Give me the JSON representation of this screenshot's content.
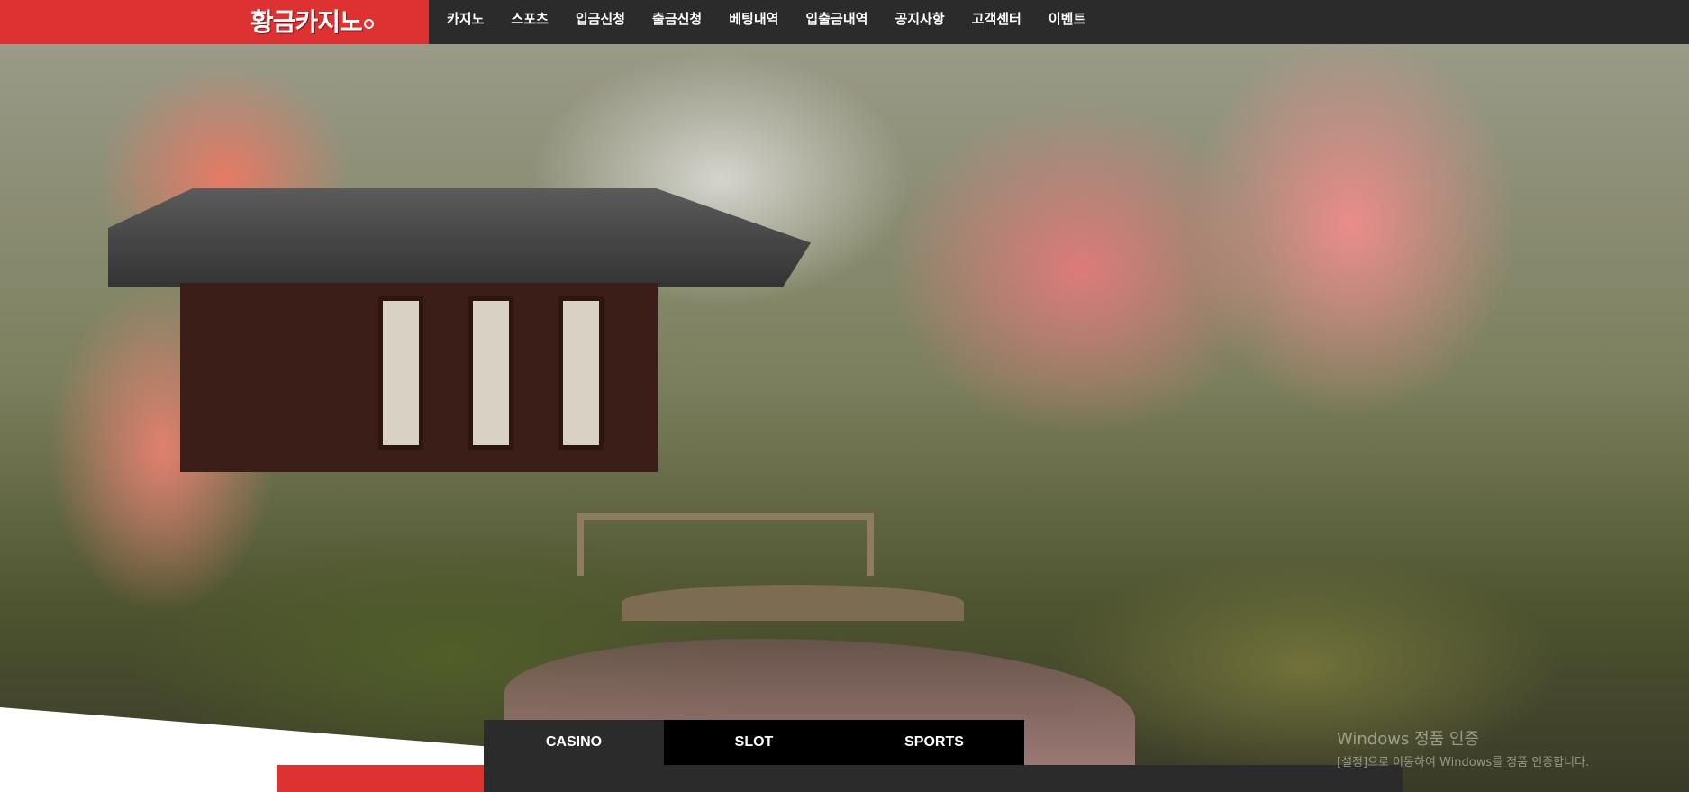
{
  "header": {
    "logo": "황금카지노",
    "nav": [
      "카지노",
      "스포츠",
      "입금신청",
      "출금신청",
      "베팅내역",
      "입출금내역",
      "공지사항",
      "고객센터",
      "이벤트"
    ]
  },
  "game_tabs": [
    {
      "label": "CASINO",
      "active": true
    },
    {
      "label": "SLOT",
      "active": false
    },
    {
      "label": "SPORTS",
      "active": false
    }
  ],
  "watermark": {
    "title": "Windows 정품 인증",
    "subtitle": "[설정]으로 이동하여 Windows를 정품 인증합니다."
  },
  "colors": {
    "brand_red": "#de3131",
    "bar_dark": "#2b2b2b",
    "tab_black": "#000000"
  }
}
